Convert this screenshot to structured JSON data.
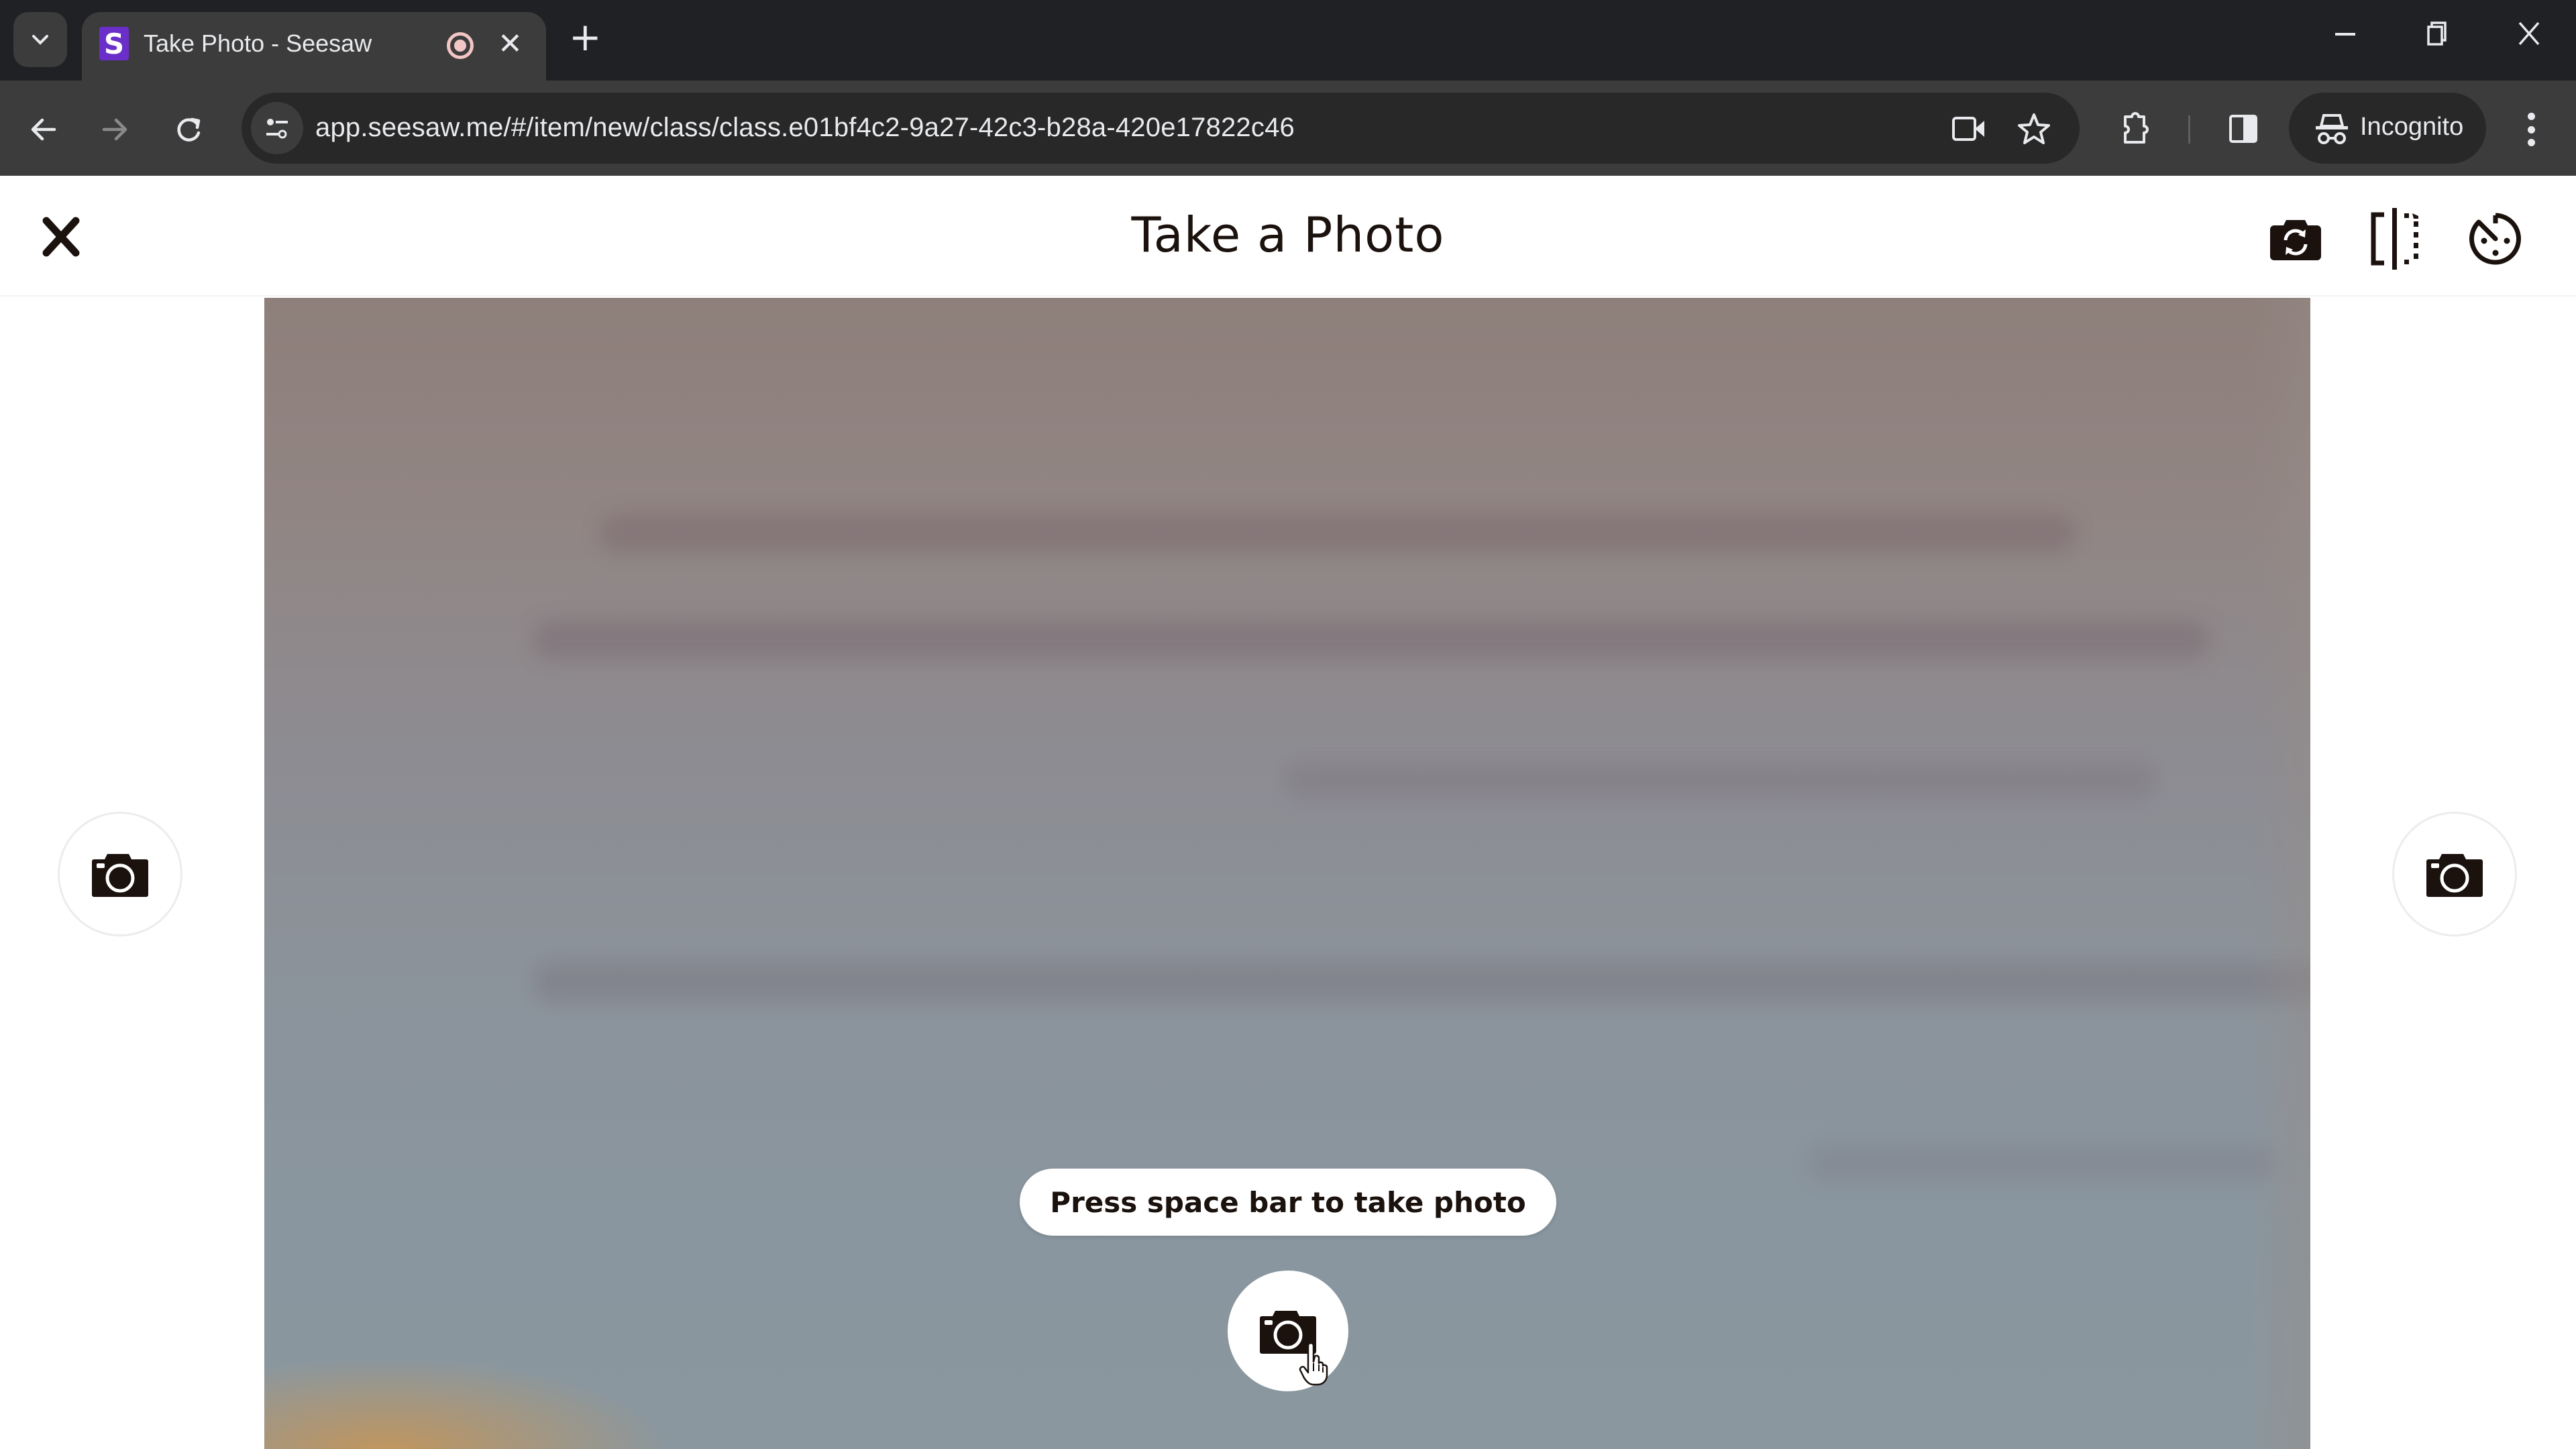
{
  "browser": {
    "tab": {
      "title": "Take Photo - Seesaw",
      "favicon_letter": "S",
      "favicon_color": "#6a2fc8",
      "recording_indicator": "recording-icon"
    },
    "new_tab_label": "+",
    "window_controls": {
      "minimize": "–",
      "restore": "❐",
      "close": "✕"
    },
    "nav": {
      "back": "←",
      "forward": "→",
      "reload": "↻"
    },
    "address_bar": {
      "url": "app.seesaw.me/#/item/new/class/class.e01bf4c2-9a27-42c3-b28a-420e17822c46"
    },
    "toolbar_icons": [
      "camera-in-use-icon",
      "bookmark-star-icon",
      "extensions-icon",
      "side-panel-icon"
    ],
    "profile": {
      "label": "Incognito"
    }
  },
  "app": {
    "header": {
      "title": "Take a Photo",
      "close_label": "Close",
      "actions": [
        {
          "name": "switch-camera",
          "label": "Switch camera"
        },
        {
          "name": "mirror",
          "label": "Mirror"
        },
        {
          "name": "timer",
          "label": "Timer"
        }
      ]
    },
    "camera": {
      "hint": "Press space bar to take photo",
      "shutter_label": "Take photo",
      "left_button_label": "Take photo",
      "right_button_label": "Take photo"
    },
    "colors": {
      "ink": "#1b120e",
      "background": "#ffffff"
    }
  }
}
